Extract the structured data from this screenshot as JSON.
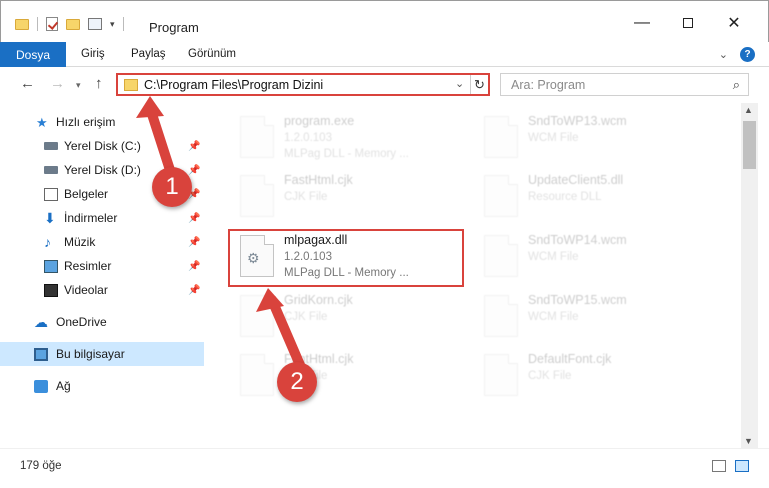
{
  "window": {
    "title": "Program",
    "minimize_icon": "minimize-icon",
    "maximize_icon": "maximize-icon",
    "close_glyph": "✕"
  },
  "ribbon": {
    "file_tab": "Dosya",
    "tabs": [
      "Giriş",
      "Paylaş",
      "Görünüm"
    ],
    "help_glyph": "?"
  },
  "address": {
    "path": "C:\\Program Files\\Program Dizini",
    "search_placeholder": "Ara: Program"
  },
  "sidebar": {
    "items": [
      {
        "label": "Hızlı erişim",
        "icon": "star-icon"
      },
      {
        "label": "Yerel Disk (C:)",
        "icon": "disk-icon",
        "pinned": true
      },
      {
        "label": "Yerel Disk (D:)",
        "icon": "disk-icon",
        "pinned": true
      },
      {
        "label": "Belgeler",
        "icon": "documents-icon",
        "pinned": true
      },
      {
        "label": "İndirmeler",
        "icon": "download-icon",
        "pinned": true
      },
      {
        "label": "Müzik",
        "icon": "music-icon",
        "pinned": true
      },
      {
        "label": "Resimler",
        "icon": "pictures-icon",
        "pinned": true
      },
      {
        "label": "Videolar",
        "icon": "videos-icon",
        "pinned": true
      },
      {
        "label": "OneDrive",
        "icon": "cloud-icon"
      },
      {
        "label": "Bu bilgisayar",
        "icon": "pc-icon",
        "selected": true
      },
      {
        "label": "Ağ",
        "icon": "network-icon"
      }
    ]
  },
  "files": {
    "left": [
      {
        "name": "program.exe",
        "line2": "1.2.0.103",
        "line3": "MLPag DLL - Memory ..."
      },
      {
        "name": "FastHtml.cjk",
        "line2": "CJK File",
        "line3": ""
      },
      {
        "name": "mlpagax.dll",
        "line2": "1.2.0.103",
        "line3": "MLPag DLL - Memory ..."
      },
      {
        "name": "GridKorn.cjk",
        "line2": "CJK File",
        "line3": ""
      },
      {
        "name": "FontHtml.cjk",
        "line2": "CJK File",
        "line3": ""
      }
    ],
    "right": [
      {
        "name": "SndToWP13.wcm",
        "line2": "WCM File",
        "line3": ""
      },
      {
        "name": "UpdateClient5.dll",
        "line2": "Resource DLL",
        "line3": ""
      },
      {
        "name": "SndToWP14.wcm",
        "line2": "WCM File",
        "line3": ""
      },
      {
        "name": "SndToWP15.wcm",
        "line2": "WCM File",
        "line3": ""
      },
      {
        "name": "DefaultFont.cjk",
        "line2": "CJK File",
        "line3": ""
      }
    ]
  },
  "status": {
    "item_count": "179 öğe"
  },
  "callouts": [
    "1",
    "2"
  ],
  "colors": {
    "accent": "#1a6fc4",
    "highlight_red": "#d9433c",
    "selection": "#cde8ff"
  }
}
